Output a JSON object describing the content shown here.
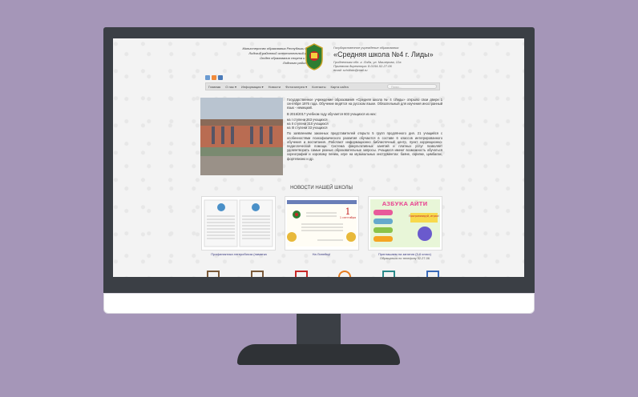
{
  "header": {
    "left_lines": [
      "Министерство образования Республики Беларусь",
      "Лидский районный исполнительный комитет",
      "Отдел образования спорта и туризма",
      "Лидского райисполкома"
    ],
    "right_small": "Государственное учреждение образования",
    "title": "«Средняя школа №4 г. Лиды»",
    "address_lines": [
      "Гродненская обл. г. Лида, ул. Машерова, 12а",
      "Приемная директора: 8-0154-52-27-06",
      "email: sch4lida@mail.ru"
    ]
  },
  "social": {
    "colors": [
      "#6b9bd1",
      "#f08a3a",
      "#4a7ab8"
    ]
  },
  "nav": {
    "items": [
      "Главная",
      "О нас ▾",
      "Информация ▾",
      "Новости",
      "Фотогалерея ▾",
      "Контакты",
      "Карта сайта"
    ],
    "search_placeholder": "Поиск..."
  },
  "intro": {
    "p1": "Государственное учреждение образования «Средняя школа № 4 г.Лиды» открыло свои двери 1 сентября 1976 года. Обучение ведётся на русском языке. Обязательный для изучения иностранный язык - немецкий.",
    "p2": "В 2016/2017 учебном году обучается 603 учащихся из них:",
    "p3a": "на I ступени 263 учащихся",
    "p3b": "на II ступени 310 учащихся",
    "p3c": "на III ступени 33 учащихся",
    "p4": "По заявлениям законных представителей открыто 5 групп продлённого дня. 21 учащийся с особенностями психофизического развития обучаются в составе 6 классов интегрированного обучения и воспитания. Работают информационно библиотечный центр, пункт коррекционно-педагогической помощи. Система факультативных занятий и платных услуг позволяет удовлетворить самые разные образовательные запросы. Учащиеся имеют возможность обучаться хореографии и хоровому пению, игре на музыкальных инструментах: баяне, скрипке, цимбалах, фортепиано и др."
  },
  "news": {
    "title": "НОВОСТИ НАШЕЙ ШКОЛЫ",
    "items": [
      {
        "label": "Профилактика энтеробиоза (памятка",
        "sub": ""
      },
      {
        "label": "На Линейку!",
        "sub": "",
        "poster_text": "1 сентября"
      },
      {
        "label": "Приглашаем на занятия (3-6 класс)",
        "sub": "Обращаться по телефону 52-27-06",
        "poster_title": "АЗБУКА АЙТИ",
        "poster_badge": "Программируй, играя!"
      }
    ]
  }
}
